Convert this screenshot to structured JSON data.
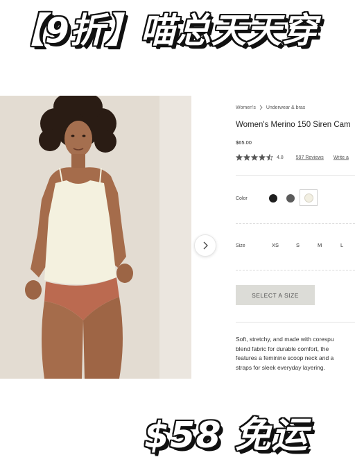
{
  "banner": {
    "top_text": "【9折】喵总天天穿",
    "bottom_text": "$58 免运"
  },
  "product_image": {
    "icon": "product-photo"
  },
  "carousel": {
    "next_icon": "chevron-right-icon"
  },
  "breadcrumb": {
    "items": [
      "Women's",
      "Underwear & bras"
    ],
    "separator_icon": "chevron-right-icon"
  },
  "product": {
    "title": "Women's Merino 150 Siren Cam",
    "price": "$65.00",
    "rating": {
      "value": "4.8",
      "stars_filled": 4.5,
      "stars_total": 5,
      "reviews_text": "597 Reviews",
      "write_text": "Write a"
    }
  },
  "color": {
    "label": "Color",
    "options": [
      {
        "name": "black",
        "hex": "#1e1e1e"
      },
      {
        "name": "grey",
        "hex": "#5b5b5b"
      },
      {
        "name": "cream",
        "hex": "#f2efe2"
      }
    ],
    "selected": "cream"
  },
  "size": {
    "label": "Size",
    "options": [
      "XS",
      "S",
      "M",
      "L"
    ]
  },
  "select_button": {
    "label": "SELECT A SIZE"
  },
  "description": {
    "lines": [
      "Soft, stretchy, and made with corespu",
      "blend fabric for durable comfort, the",
      "features a feminine scoop neck and a",
      "straps for sleek everyday layering."
    ]
  },
  "colors": {
    "star": "#555555",
    "button_bg": "#dcdcd7",
    "banner_fill": "#ffffff",
    "banner_outline": "#111111"
  }
}
